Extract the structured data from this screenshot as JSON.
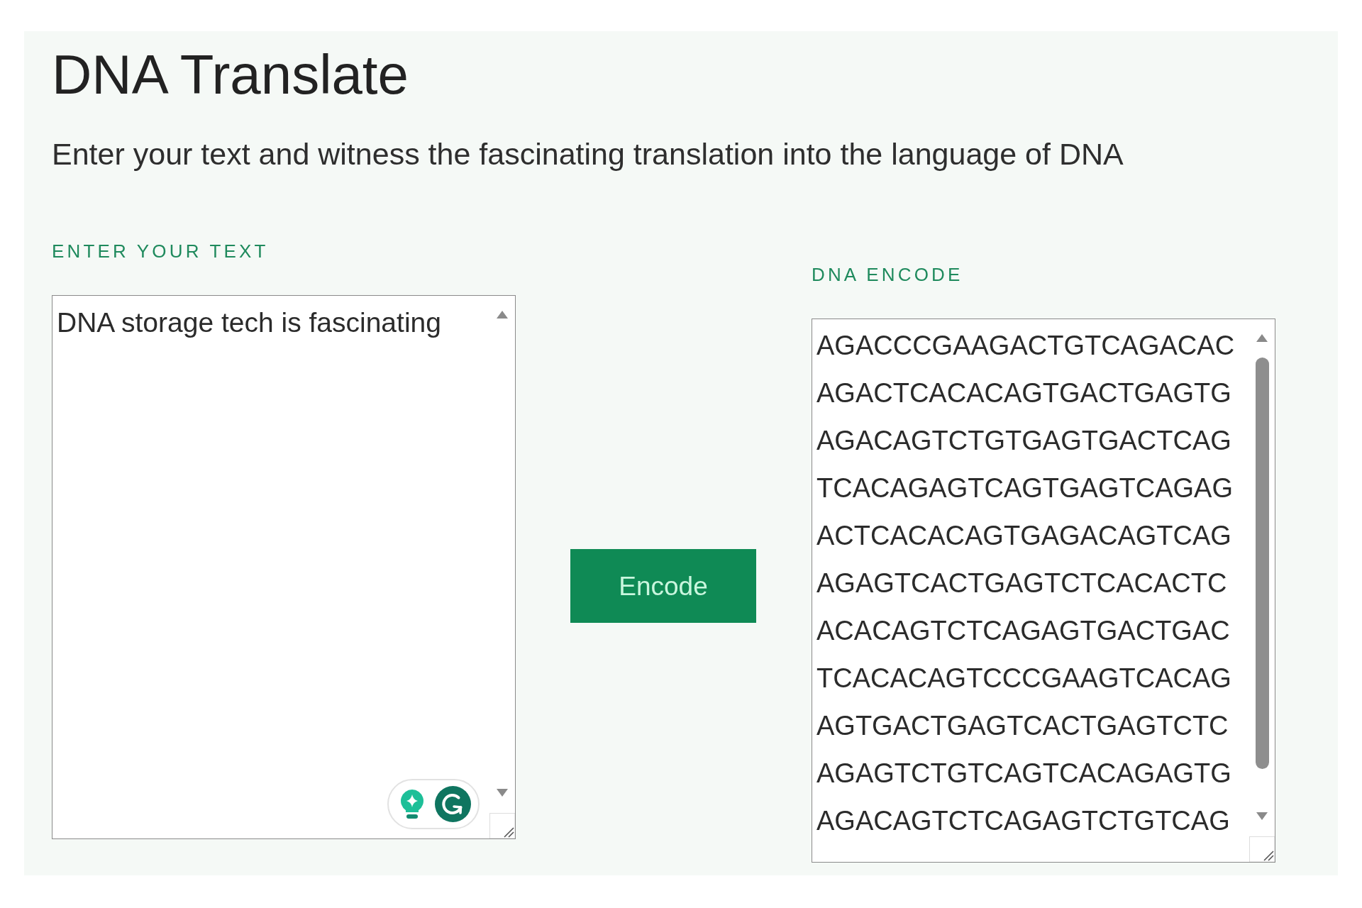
{
  "page": {
    "title": "DNA Translate",
    "subtitle": "Enter your text and witness the fascinating translation into the language of DNA"
  },
  "input": {
    "label": "ENTER YOUR TEXT",
    "value": "DNA storage tech is fascinating"
  },
  "action": {
    "label": "Encode"
  },
  "output": {
    "label": "DNA ENCODE",
    "lines": [
      "AGACCCGAAGACTGTCAGACAC",
      "AGACTCACACAGTGACTGAGTG",
      "AGACAGTCTGTGAGTGACTCAG",
      "TCACAGAGTCAGTGAGTCAGAG",
      "ACTCACACAGTGAGACAGTCAG",
      "AGAGTCACTGAGTCTCACACTC",
      "ACACAGTCTCAGAGTGACTGAC",
      "TCACACAGTCCCGAAGTCACAG",
      "AGTGACTGAGTCACTGAGTCTC",
      "AGAGTCTGTCAGTCACAGAGTG",
      "AGACAGTCTCAGAGTCTGTCAG"
    ]
  }
}
